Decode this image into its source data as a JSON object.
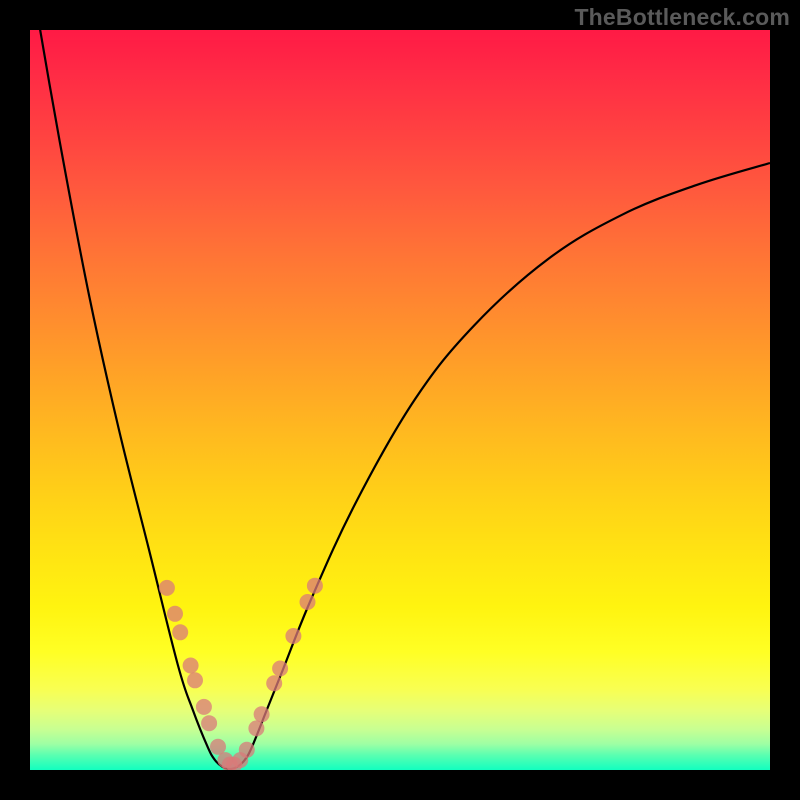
{
  "watermark": "TheBottleneck.com",
  "colors": {
    "curve": "#000000",
    "marker_fill": "#d97a7a",
    "marker_stroke": "#c86a6a",
    "gradient_top": "#ff1a45",
    "gradient_bottom": "#12ffbf"
  },
  "chart_data": {
    "type": "line",
    "title": "",
    "xlabel": "",
    "ylabel": "",
    "xlim": [
      0,
      100
    ],
    "ylim": [
      0,
      100
    ],
    "series": [
      {
        "name": "bottleneck-curve",
        "description": "V-shaped bottleneck curve; minimum ≈ x 27, y 0. Values estimated from plot pixels (axes unlabeled).",
        "x": [
          0,
          4,
          8,
          12,
          16,
          20,
          22,
          24,
          25,
          26,
          27,
          28,
          29,
          30,
          32,
          34,
          38,
          44,
          52,
          60,
          70,
          80,
          90,
          100
        ],
        "y": [
          108,
          85,
          64,
          46,
          30,
          14,
          8,
          3,
          1.2,
          0.3,
          0,
          0.3,
          1.2,
          3,
          8,
          13,
          23,
          36,
          50,
          60,
          69,
          75,
          79,
          82
        ]
      }
    ],
    "markers": {
      "name": "highlighted-points",
      "description": "Pink dots clustered near the curve bottom on both arms.",
      "points": [
        {
          "x": 18.5,
          "y": 24.5
        },
        {
          "x": 19.6,
          "y": 21.0
        },
        {
          "x": 20.3,
          "y": 18.5
        },
        {
          "x": 21.7,
          "y": 14.0
        },
        {
          "x": 22.3,
          "y": 12.0
        },
        {
          "x": 23.5,
          "y": 8.4
        },
        {
          "x": 24.2,
          "y": 6.2
        },
        {
          "x": 25.4,
          "y": 3.0
        },
        {
          "x": 26.4,
          "y": 1.2
        },
        {
          "x": 27.0,
          "y": 0.6
        },
        {
          "x": 27.6,
          "y": 0.6
        },
        {
          "x": 28.4,
          "y": 1.2
        },
        {
          "x": 29.3,
          "y": 2.6
        },
        {
          "x": 30.6,
          "y": 5.5
        },
        {
          "x": 31.3,
          "y": 7.4
        },
        {
          "x": 33.0,
          "y": 11.6
        },
        {
          "x": 33.8,
          "y": 13.6
        },
        {
          "x": 35.6,
          "y": 18.0
        },
        {
          "x": 37.5,
          "y": 22.6
        },
        {
          "x": 38.5,
          "y": 24.8
        }
      ]
    }
  }
}
